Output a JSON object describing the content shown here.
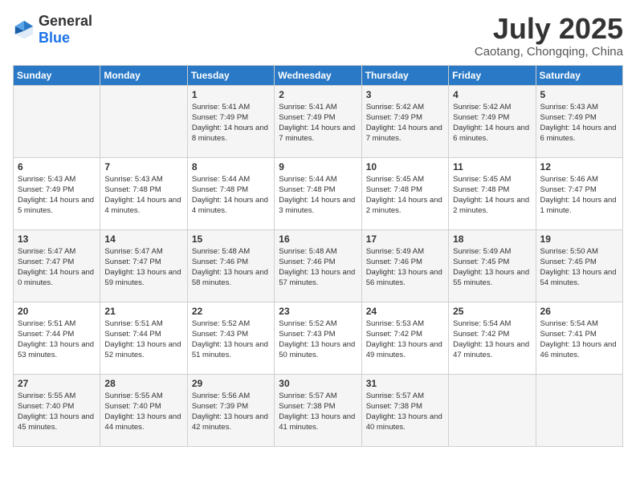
{
  "header": {
    "logo_general": "General",
    "logo_blue": "Blue",
    "month_year": "July 2025",
    "location": "Caotang, Chongqing, China"
  },
  "weekdays": [
    "Sunday",
    "Monday",
    "Tuesday",
    "Wednesday",
    "Thursday",
    "Friday",
    "Saturday"
  ],
  "weeks": [
    [
      {
        "day": "",
        "info": ""
      },
      {
        "day": "",
        "info": ""
      },
      {
        "day": "1",
        "info": "Sunrise: 5:41 AM\nSunset: 7:49 PM\nDaylight: 14 hours and 8 minutes."
      },
      {
        "day": "2",
        "info": "Sunrise: 5:41 AM\nSunset: 7:49 PM\nDaylight: 14 hours and 7 minutes."
      },
      {
        "day": "3",
        "info": "Sunrise: 5:42 AM\nSunset: 7:49 PM\nDaylight: 14 hours and 7 minutes."
      },
      {
        "day": "4",
        "info": "Sunrise: 5:42 AM\nSunset: 7:49 PM\nDaylight: 14 hours and 6 minutes."
      },
      {
        "day": "5",
        "info": "Sunrise: 5:43 AM\nSunset: 7:49 PM\nDaylight: 14 hours and 6 minutes."
      }
    ],
    [
      {
        "day": "6",
        "info": "Sunrise: 5:43 AM\nSunset: 7:49 PM\nDaylight: 14 hours and 5 minutes."
      },
      {
        "day": "7",
        "info": "Sunrise: 5:43 AM\nSunset: 7:48 PM\nDaylight: 14 hours and 4 minutes."
      },
      {
        "day": "8",
        "info": "Sunrise: 5:44 AM\nSunset: 7:48 PM\nDaylight: 14 hours and 4 minutes."
      },
      {
        "day": "9",
        "info": "Sunrise: 5:44 AM\nSunset: 7:48 PM\nDaylight: 14 hours and 3 minutes."
      },
      {
        "day": "10",
        "info": "Sunrise: 5:45 AM\nSunset: 7:48 PM\nDaylight: 14 hours and 2 minutes."
      },
      {
        "day": "11",
        "info": "Sunrise: 5:45 AM\nSunset: 7:48 PM\nDaylight: 14 hours and 2 minutes."
      },
      {
        "day": "12",
        "info": "Sunrise: 5:46 AM\nSunset: 7:47 PM\nDaylight: 14 hours and 1 minute."
      }
    ],
    [
      {
        "day": "13",
        "info": "Sunrise: 5:47 AM\nSunset: 7:47 PM\nDaylight: 14 hours and 0 minutes."
      },
      {
        "day": "14",
        "info": "Sunrise: 5:47 AM\nSunset: 7:47 PM\nDaylight: 13 hours and 59 minutes."
      },
      {
        "day": "15",
        "info": "Sunrise: 5:48 AM\nSunset: 7:46 PM\nDaylight: 13 hours and 58 minutes."
      },
      {
        "day": "16",
        "info": "Sunrise: 5:48 AM\nSunset: 7:46 PM\nDaylight: 13 hours and 57 minutes."
      },
      {
        "day": "17",
        "info": "Sunrise: 5:49 AM\nSunset: 7:46 PM\nDaylight: 13 hours and 56 minutes."
      },
      {
        "day": "18",
        "info": "Sunrise: 5:49 AM\nSunset: 7:45 PM\nDaylight: 13 hours and 55 minutes."
      },
      {
        "day": "19",
        "info": "Sunrise: 5:50 AM\nSunset: 7:45 PM\nDaylight: 13 hours and 54 minutes."
      }
    ],
    [
      {
        "day": "20",
        "info": "Sunrise: 5:51 AM\nSunset: 7:44 PM\nDaylight: 13 hours and 53 minutes."
      },
      {
        "day": "21",
        "info": "Sunrise: 5:51 AM\nSunset: 7:44 PM\nDaylight: 13 hours and 52 minutes."
      },
      {
        "day": "22",
        "info": "Sunrise: 5:52 AM\nSunset: 7:43 PM\nDaylight: 13 hours and 51 minutes."
      },
      {
        "day": "23",
        "info": "Sunrise: 5:52 AM\nSunset: 7:43 PM\nDaylight: 13 hours and 50 minutes."
      },
      {
        "day": "24",
        "info": "Sunrise: 5:53 AM\nSunset: 7:42 PM\nDaylight: 13 hours and 49 minutes."
      },
      {
        "day": "25",
        "info": "Sunrise: 5:54 AM\nSunset: 7:42 PM\nDaylight: 13 hours and 47 minutes."
      },
      {
        "day": "26",
        "info": "Sunrise: 5:54 AM\nSunset: 7:41 PM\nDaylight: 13 hours and 46 minutes."
      }
    ],
    [
      {
        "day": "27",
        "info": "Sunrise: 5:55 AM\nSunset: 7:40 PM\nDaylight: 13 hours and 45 minutes."
      },
      {
        "day": "28",
        "info": "Sunrise: 5:55 AM\nSunset: 7:40 PM\nDaylight: 13 hours and 44 minutes."
      },
      {
        "day": "29",
        "info": "Sunrise: 5:56 AM\nSunset: 7:39 PM\nDaylight: 13 hours and 42 minutes."
      },
      {
        "day": "30",
        "info": "Sunrise: 5:57 AM\nSunset: 7:38 PM\nDaylight: 13 hours and 41 minutes."
      },
      {
        "day": "31",
        "info": "Sunrise: 5:57 AM\nSunset: 7:38 PM\nDaylight: 13 hours and 40 minutes."
      },
      {
        "day": "",
        "info": ""
      },
      {
        "day": "",
        "info": ""
      }
    ]
  ]
}
